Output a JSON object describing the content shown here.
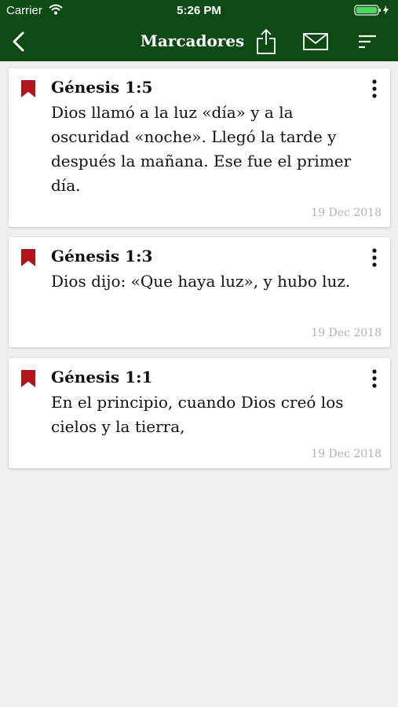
{
  "status_bar": {
    "carrier": "Carrier",
    "time": "5:26 PM"
  },
  "nav": {
    "title": "Marcadores"
  },
  "colors": {
    "nav_background": "#0d4a14",
    "bookmark": "#b3141b",
    "page_background": "#efeff1"
  },
  "icons": {
    "back": "chevron-left-icon",
    "share": "share-icon",
    "mail": "mail-icon",
    "sort": "sort-icon",
    "bookmark": "bookmark-icon",
    "menu": "more-vertical-icon"
  },
  "bookmarks": [
    {
      "reference": "Génesis 1:5",
      "text": "Dios llamó a la luz «día» y a la oscuridad «noche». Llegó la tarde y después la mañana. Ese fue el primer día.",
      "date": "19 Dec 2018"
    },
    {
      "reference": "Génesis 1:3",
      "text": "Dios dijo: «Que haya luz», y hubo luz.",
      "date": "19 Dec 2018"
    },
    {
      "reference": "Génesis 1:1",
      "text": "En el principio, cuando Dios creó los cielos y la tierra,",
      "date": "19 Dec 2018"
    }
  ]
}
